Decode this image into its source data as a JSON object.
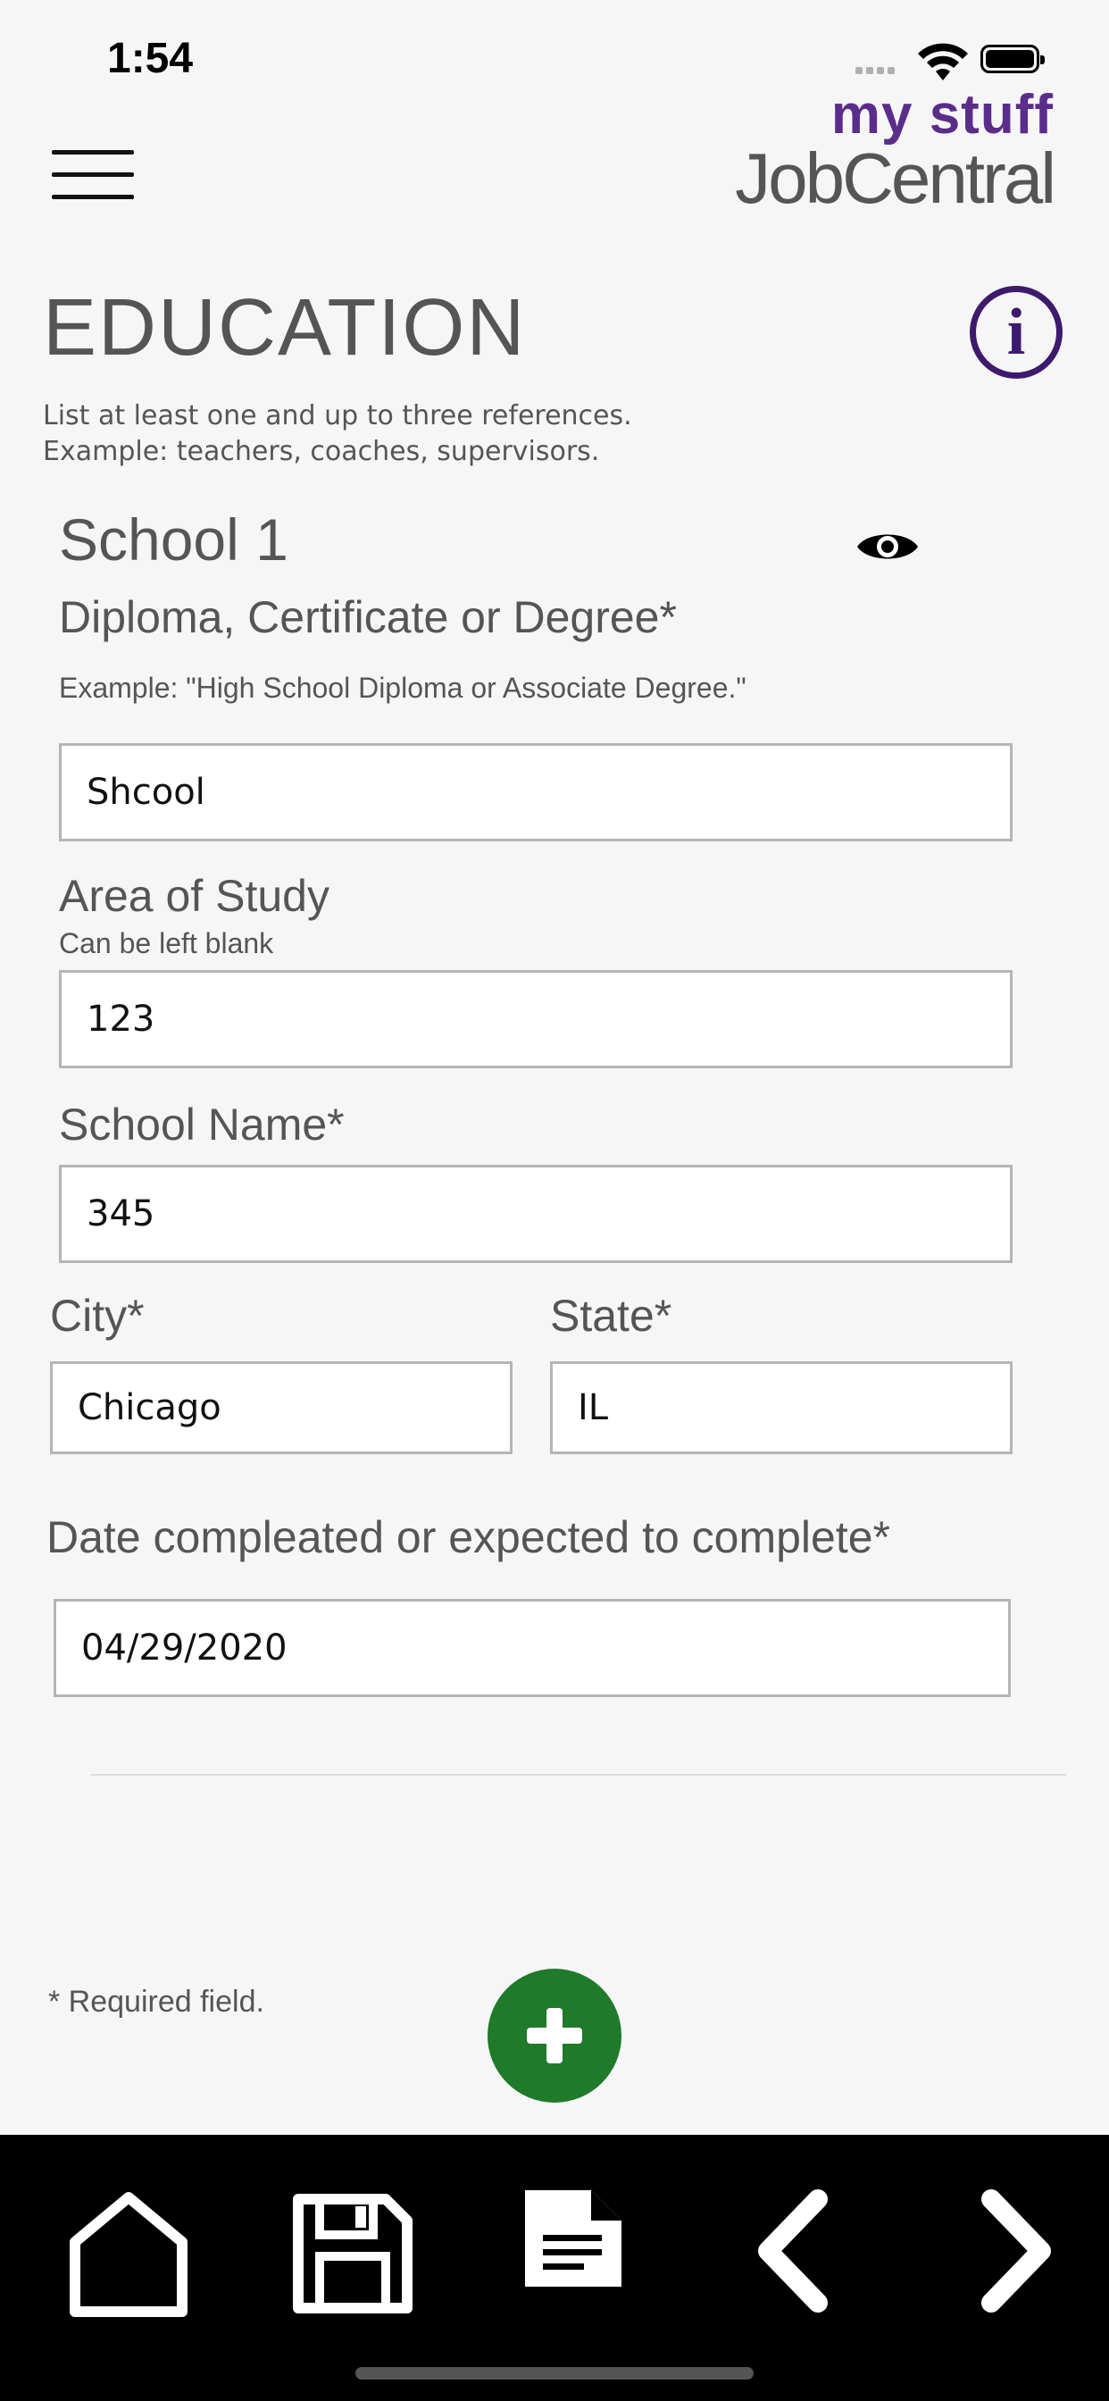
{
  "status_bar": {
    "time": "1:54"
  },
  "header": {
    "logo_top": "my stuff",
    "logo_bottom": "JobCentral",
    "brand_color": "#5a2d8a"
  },
  "page": {
    "title": "EDUCATION",
    "intro_line1": "List at least one and up to three references.",
    "intro_line2": "Example: teachers, coaches, supervisors."
  },
  "school": {
    "heading": "School 1",
    "degree_label": "Diploma, Certificate or Degree*",
    "degree_hint": "Example: \"High School Diploma or Associate Degree.\"",
    "degree_value": "Shcool",
    "study_label": "Area of Study",
    "study_hint": "Can be left blank",
    "study_value": "123",
    "name_label": "School Name*",
    "name_value": "345",
    "city_label": "City*",
    "city_value": "Chicago",
    "state_label": "State*",
    "state_value": "IL",
    "date_label": "Date compleated or expected to complete*",
    "date_value": "04/29/2020"
  },
  "footer": {
    "required_note": "* Required field.",
    "add_button_color": "#1f7a2a"
  },
  "bottom_nav": {
    "icons": [
      "home-icon",
      "save-icon",
      "document-icon",
      "back-chevron-icon",
      "forward-chevron-icon"
    ]
  }
}
